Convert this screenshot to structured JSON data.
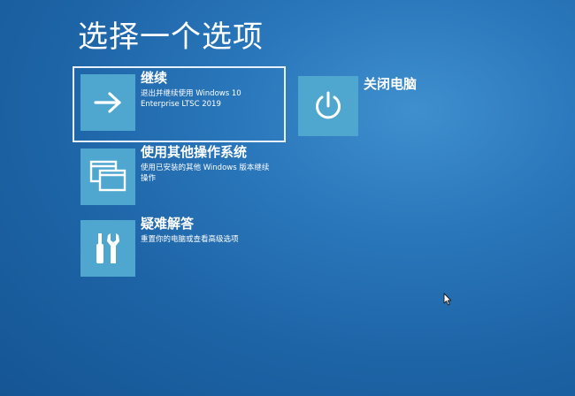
{
  "page": {
    "title": "选择一个选项"
  },
  "options": [
    {
      "title": "继续",
      "description": "退出并继续使用 Windows 10 Enterprise LTSC 2019",
      "icon": "arrow-right-icon",
      "selected": true
    },
    {
      "title": "使用其他操作系统",
      "description": "使用已安装的其他 Windows 版本继续操作",
      "icon": "windows-stack-icon",
      "selected": false
    },
    {
      "title": "疑难解答",
      "description": "重置你的电脑或查看高级选项",
      "icon": "tools-icon",
      "selected": false
    }
  ],
  "power": {
    "label": "关闭电脑",
    "icon": "power-icon"
  },
  "colors": {
    "tile": "#4fa6cf",
    "background": "#1d64a6",
    "text": "#ffffff"
  }
}
